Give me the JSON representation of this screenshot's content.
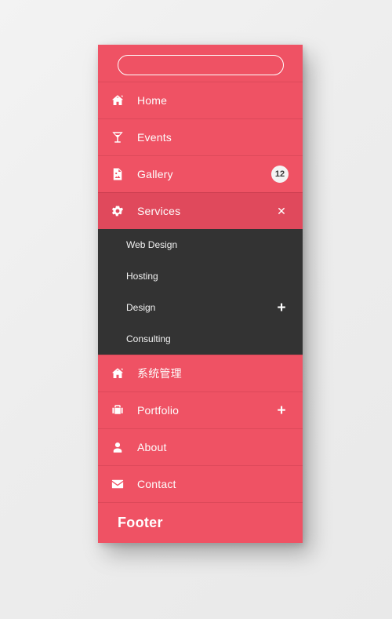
{
  "theme": {
    "accent": "#ef5264",
    "accent_active": "#e0495c",
    "submenu_bg": "#333333",
    "page_bg": "#f0f0f0",
    "text": "#ffffff",
    "badge_bg": "#f4f4f4",
    "badge_text": "#3a3a3a"
  },
  "search": {
    "value": "",
    "placeholder": ""
  },
  "menu": {
    "items": [
      {
        "label": "Home",
        "icon": "home-icon",
        "badge": null,
        "indicator": null,
        "active": false,
        "cjk": false
      },
      {
        "label": "Events",
        "icon": "cocktail-icon",
        "badge": null,
        "indicator": null,
        "active": false,
        "cjk": false
      },
      {
        "label": "Gallery",
        "icon": "image-file-icon",
        "badge": "12",
        "indicator": null,
        "active": false,
        "cjk": false
      },
      {
        "label": "Services",
        "icon": "gear-icon",
        "badge": null,
        "indicator": "close",
        "active": true,
        "cjk": false
      },
      {
        "label": "系统管理",
        "icon": "home-icon",
        "badge": null,
        "indicator": null,
        "active": false,
        "cjk": true
      },
      {
        "label": "Portfolio",
        "icon": "briefcase-icon",
        "badge": null,
        "indicator": "plus",
        "active": false,
        "cjk": false
      },
      {
        "label": "About",
        "icon": "user-icon",
        "badge": null,
        "indicator": null,
        "active": false,
        "cjk": false
      },
      {
        "label": "Contact",
        "icon": "envelope-icon",
        "badge": null,
        "indicator": null,
        "active": false,
        "cjk": false
      }
    ]
  },
  "submenu": {
    "parent": "Services",
    "items": [
      {
        "label": "Web Design",
        "indicator": null
      },
      {
        "label": "Hosting",
        "indicator": null
      },
      {
        "label": "Design",
        "indicator": "plus"
      },
      {
        "label": "Consulting",
        "indicator": null
      }
    ]
  },
  "footer": {
    "label": "Footer"
  },
  "indicators": {
    "plus_glyph": "+",
    "close_glyph": "✕"
  }
}
